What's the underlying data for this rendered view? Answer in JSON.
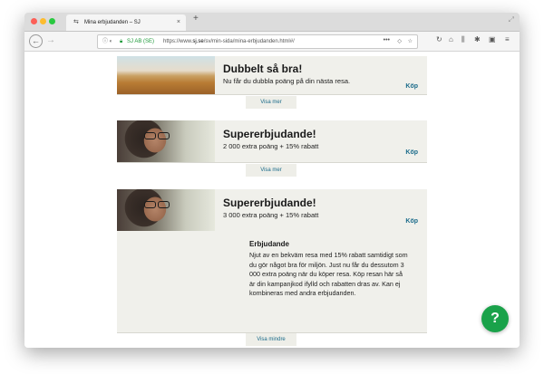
{
  "browser": {
    "tab_title": "Mina erbjudanden – SJ",
    "tab_close": "×",
    "new_tab": "+",
    "url_org": "SJ AB (SE)",
    "url_prefix": "https://www.",
    "url_domain": "sj.se",
    "url_path": "/sv/min-sida/mina-erbjudanden.html#/",
    "menu_dots": "•••"
  },
  "offers": [
    {
      "heading": "Dubbelt så bra!",
      "sub": "Nu får du dubbla poäng på din nästa resa.",
      "buy": "Köp",
      "toggle": "Visa mer"
    },
    {
      "heading": "Supererbjudande!",
      "sub": "2 000 extra poäng + 15% rabatt",
      "buy": "Köp",
      "toggle": "Visa mer"
    },
    {
      "heading": "Supererbjudande!",
      "sub": "3 000 extra poäng + 15% rabatt",
      "buy": "Köp",
      "toggle": "Visa mindre"
    }
  ],
  "details": {
    "title": "Erbjudande",
    "body": "Njut av en bekväm resa med 15% rabatt samtidigt som du gör något bra för miljön. Just nu får du dessutom 3 000 extra poäng när du köper resa. Köp resan här så är din kampanjkod ifylld och rabatten dras av. Kan ej kombineras med andra erbjudanden."
  },
  "help": {
    "label": "?"
  },
  "colors": {
    "accent": "#1a6b8a",
    "help_green": "#1aa24a",
    "card_bg": "#f0f0eb"
  }
}
